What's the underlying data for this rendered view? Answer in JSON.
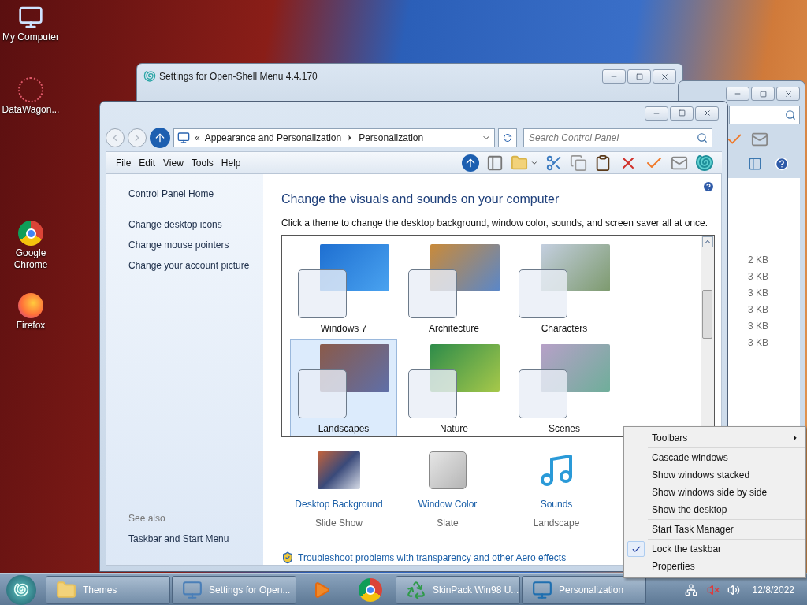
{
  "desktop_icons": [
    {
      "label": "My Computer"
    },
    {
      "label": "DataWagon..."
    },
    {
      "label": "Google Chrome"
    },
    {
      "label": "Firefox"
    }
  ],
  "back_window": {
    "title": "Settings for Open-Shell Menu 4.4.170"
  },
  "side_window": {
    "file_sizes": [
      "2 KB",
      "3 KB",
      "3 KB",
      "3 KB",
      "3 KB",
      "3 KB"
    ]
  },
  "window": {
    "breadcrumb": [
      "Appearance and Personalization",
      "Personalization"
    ],
    "breadcrumb_prefix": "«",
    "search": {
      "placeholder": "Search Control Panel"
    },
    "menu": [
      "File",
      "Edit",
      "View",
      "Tools",
      "Help"
    ],
    "sidebar": {
      "home": "Control Panel Home",
      "links": [
        "Change desktop icons",
        "Change mouse pointers",
        "Change your account picture"
      ],
      "see_also": {
        "heading": "See also",
        "links": [
          "Taskbar and Start Menu"
        ]
      }
    },
    "heading": "Change the visuals and sounds on your computer",
    "description": "Click a theme to change the desktop background, window color, sounds, and screen saver all at once.",
    "themes": [
      {
        "name": "Windows 7",
        "selected": false
      },
      {
        "name": "Architecture",
        "selected": false
      },
      {
        "name": "Characters",
        "selected": false
      },
      {
        "name": "Landscapes",
        "selected": true
      },
      {
        "name": "Nature",
        "selected": false
      },
      {
        "name": "Scenes",
        "selected": false
      }
    ],
    "settings": [
      {
        "label": "Desktop Background",
        "value": "Slide Show"
      },
      {
        "label": "Window Color",
        "value": "Slate"
      },
      {
        "label": "Sounds",
        "value": "Landscape"
      }
    ],
    "troubleshoot_link": "Troubleshoot problems with transparency and other Aero effects"
  },
  "taskbar": {
    "items": [
      {
        "kind": "button",
        "label": "Themes"
      },
      {
        "kind": "button",
        "label": "Settings for Open..."
      },
      {
        "kind": "pinned"
      },
      {
        "kind": "pinned"
      },
      {
        "kind": "button",
        "label": "SkinPack Win98 U..."
      },
      {
        "kind": "button",
        "label": "Personalization"
      }
    ],
    "clock": "12/8/2022"
  },
  "context_menu": {
    "groups": [
      [
        {
          "label": "Toolbars",
          "checked": false,
          "submenu": true
        }
      ],
      [
        {
          "label": "Cascade windows",
          "checked": false,
          "submenu": false
        },
        {
          "label": "Show windows stacked",
          "checked": false,
          "submenu": false
        },
        {
          "label": "Show windows side by side",
          "checked": false,
          "submenu": false
        },
        {
          "label": "Show the desktop",
          "checked": false,
          "submenu": false
        }
      ],
      [
        {
          "label": "Start Task Manager",
          "checked": false,
          "submenu": false
        }
      ],
      [
        {
          "label": "Lock the taskbar",
          "checked": true,
          "submenu": false
        },
        {
          "label": "Properties",
          "checked": false,
          "submenu": false
        }
      ]
    ]
  }
}
